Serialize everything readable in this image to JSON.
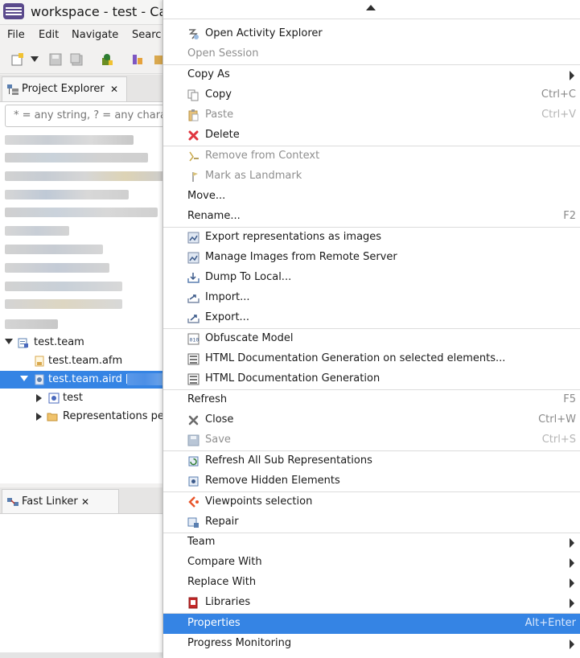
{
  "window": {
    "title": "workspace - test - Cape"
  },
  "menubar": {
    "items": [
      "File",
      "Edit",
      "Navigate",
      "Searc"
    ]
  },
  "project_explorer": {
    "tab_label": "Project Explorer",
    "filter_placeholder": "* = any string, ? = any chara",
    "tree": {
      "project": "test.team",
      "afm": "test.team.afm",
      "aird": "test.team.aird [",
      "test": "test",
      "representations": "Representations pe"
    }
  },
  "fast_linker": {
    "tab_label": "Fast Linker"
  },
  "context_menu": {
    "items": [
      {
        "label": "Open Activity Explorer",
        "icon": "activity-explorer-icon"
      },
      {
        "label": "Open Session",
        "disabled": true
      },
      {
        "label": "Copy As",
        "submenu": true
      },
      {
        "label": "Copy",
        "shortcut": "Ctrl+C",
        "icon": "copy-icon"
      },
      {
        "label": "Paste",
        "shortcut": "Ctrl+V",
        "icon": "paste-icon",
        "disabled": true
      },
      {
        "label": "Delete",
        "icon": "delete-icon"
      },
      {
        "label": "Remove from Context",
        "icon": "remove-context-icon",
        "disabled": true
      },
      {
        "label": "Mark as Landmark",
        "icon": "landmark-icon",
        "disabled": true
      },
      {
        "label": "Move..."
      },
      {
        "label": "Rename...",
        "shortcut": "F2"
      },
      {
        "label": "Export representations as images",
        "icon": "export-images-icon"
      },
      {
        "label": "Manage Images from Remote Server",
        "icon": "manage-images-icon"
      },
      {
        "label": "Dump To Local...",
        "icon": "dump-icon"
      },
      {
        "label": "Import...",
        "icon": "import-icon"
      },
      {
        "label": "Export...",
        "icon": "export-icon"
      },
      {
        "label": "Obfuscate Model",
        "icon": "obfuscate-icon"
      },
      {
        "label": "HTML Documentation Generation on selected elements...",
        "icon": "html-doc-icon"
      },
      {
        "label": "HTML Documentation Generation",
        "icon": "html-doc-icon"
      },
      {
        "label": "Refresh",
        "shortcut": "F5"
      },
      {
        "label": "Close",
        "shortcut": "Ctrl+W",
        "icon": "close-icon"
      },
      {
        "label": "Save",
        "shortcut": "Ctrl+S",
        "icon": "save-icon",
        "disabled": true
      },
      {
        "label": "Refresh All Sub Representations",
        "icon": "refresh-sub-icon"
      },
      {
        "label": "Remove Hidden Elements",
        "icon": "remove-hidden-icon"
      },
      {
        "label": "Viewpoints selection",
        "icon": "viewpoints-icon"
      },
      {
        "label": "Repair",
        "icon": "repair-icon"
      },
      {
        "label": "Team",
        "submenu": true
      },
      {
        "label": "Compare With",
        "submenu": true
      },
      {
        "label": "Replace With",
        "submenu": true
      },
      {
        "label": "Libraries",
        "icon": "libraries-icon",
        "submenu": true
      },
      {
        "label": "Properties",
        "shortcut": "Alt+Enter",
        "selected": true
      },
      {
        "label": "Progress Monitoring",
        "submenu": true
      }
    ]
  },
  "colors": {
    "selection": "#3584e4",
    "delete_red": "#e0363f"
  }
}
